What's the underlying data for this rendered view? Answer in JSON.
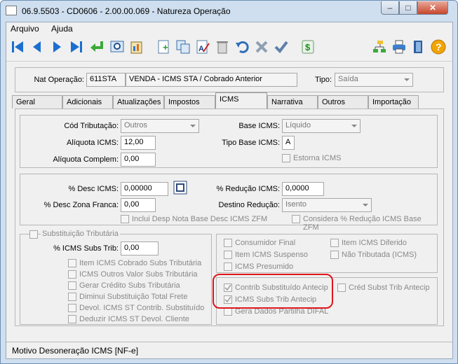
{
  "window": {
    "title": "06.9.5503 - CD0606 - 2.00.00.069 - Natureza Operação",
    "min": "–",
    "max": "□",
    "close": "✕"
  },
  "menu": {
    "arquivo": "Arquivo",
    "ajuda": "Ajuda"
  },
  "header": {
    "nat_label": "Nat Operação:",
    "nat_code": "611STA",
    "nat_desc": "VENDA - ICMS STA / Cobrado Anterior",
    "tipo_label": "Tipo:",
    "tipo_value": "Saída"
  },
  "tabs": [
    "Geral",
    "Adicionais",
    "Atualizações",
    "Impostos",
    "ICMS",
    "Narrativa",
    "Outros",
    "Importação"
  ],
  "icms": {
    "cod_trib_label": "Cód Tributação:",
    "cod_trib_value": "Outros",
    "aliq_label": "Alíquota ICMS:",
    "aliq_value": "12,00",
    "aliq_comp_label": "Alíquota Complem:",
    "aliq_comp_value": "0,00",
    "base_label": "Base ICMS:",
    "base_value": "Líquido",
    "tipo_base_label": "Tipo Base ICMS:",
    "tipo_base_value": "A",
    "estorna_label": "Estorna ICMS"
  },
  "desc": {
    "pct_desc_label": "% Desc ICMS:",
    "pct_desc_value": "0,00000",
    "zona_label": "% Desc Zona Franca:",
    "zona_value": "0,00",
    "reducao_label": "% Redução ICMS:",
    "reducao_value": "0,0000",
    "destino_label": "Destino Redução:",
    "destino_value": "Isento",
    "inclui_label": "Inclui Desp Nota Base Desc ICMS ZFM",
    "considera_label": "Considera % Redução ICMS Base ZFM"
  },
  "subst": {
    "title": "Substituição Tributária",
    "pct_label": "% ICMS Subs Trib:",
    "pct_value": "0,00",
    "items": [
      "Item ICMS Cobrado Subs Tributária",
      "ICMS Outros Valor Subs Tributária",
      "Gerar Crédito Subs Tributária",
      "Diminui Substituição Total Frete",
      "Devol. ICMS ST Contrib. Substituído",
      "Deduzir ICMS ST Devol. Cliente"
    ]
  },
  "right_checks": {
    "consumidor": "Consumidor Final",
    "item_diferido": "Item ICMS Diferido",
    "item_suspenso": "Item ICMS Suspenso",
    "nao_tributada": "Não Tributada (ICMS)",
    "presumido": "ICMS Presumido",
    "contrib": "Contrib Substituído Antecip",
    "cred_subst": "Créd Subst Trib Antecip",
    "icms_subs": "ICMS Subs Trib Antecip",
    "gera_dados": "Gera Dados Partilha DIFAL"
  },
  "status": "Motivo Desoneração ICMS [NF-e]"
}
